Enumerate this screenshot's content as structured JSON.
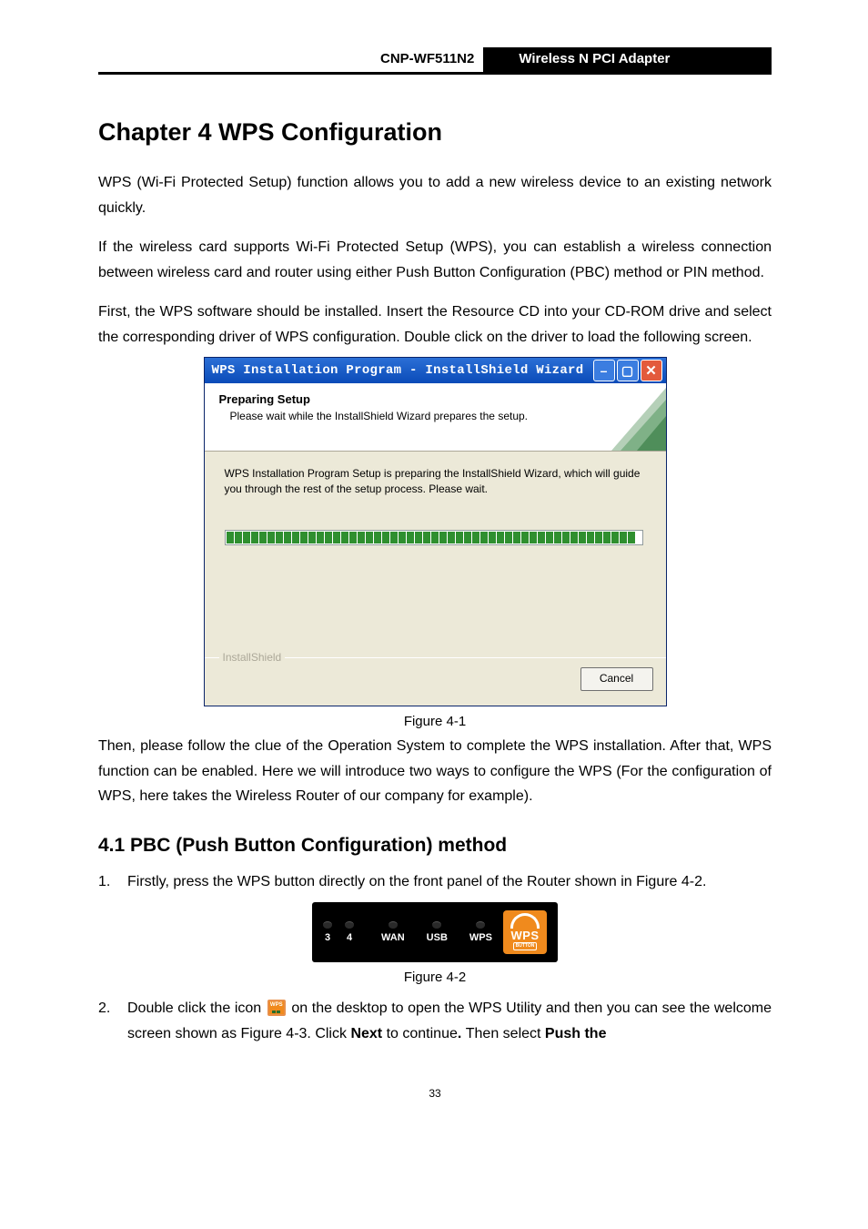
{
  "header": {
    "model": "CNP-WF511N2",
    "product": "Wireless N PCI Adapter"
  },
  "chapter_title": "Chapter 4  WPS Configuration",
  "paragraphs": {
    "p1": "WPS (Wi-Fi Protected Setup) function allows you to add a new wireless device to an existing network quickly.",
    "p2": "If the wireless card supports Wi-Fi Protected Setup (WPS), you can establish a wireless connection between wireless card and router using either Push Button Configuration (PBC) method or PIN method.",
    "p3": "First, the WPS software should be installed. Insert the Resource CD into your CD-ROM drive and select the corresponding driver of WPS configuration. Double click on the driver to load the following screen.",
    "p4": "Then, please follow the clue of the Operation System to complete the WPS installation. After that, WPS function can be enabled. Here we will introduce two ways to configure the WPS (For the configuration of WPS, here takes the Wireless Router of our company for example)."
  },
  "dialog": {
    "title": "WPS Installation Program - InstallShield Wizard",
    "header_title": "Preparing Setup",
    "header_sub": "Please wait while the InstallShield Wizard prepares the setup.",
    "body_text": "WPS Installation Program Setup is preparing the InstallShield Wizard, which will guide you through the rest of the setup process. Please wait.",
    "footer_label": "InstallShield",
    "cancel_label": "Cancel",
    "min_glyph": "–",
    "max_glyph": "▢",
    "close_glyph": "✕"
  },
  "figure_captions": {
    "fig1": "Figure 4-1",
    "fig2": "Figure 4-2"
  },
  "section_title": "4.1   PBC (Push Button Configuration) method",
  "list": {
    "item1_num": "1.",
    "item1_text": "Firstly, press the WPS button directly on the front panel of the Router shown in Figure 4-2.",
    "item2_num": "2.",
    "item2_a": "Double click the icon ",
    "item2_b": " on the desktop to open the WPS Utility and then you can see the welcome screen shown as Figure 4-3. Click ",
    "item2_next": "Next",
    "item2_c": " to continue",
    "item2_dot": ". ",
    "item2_d": "Then select ",
    "item2_push": "Push the"
  },
  "router": {
    "led3": "3",
    "led4": "4",
    "wan": "WAN",
    "usb": "USB",
    "wps": "WPS",
    "wps_btn_text": "WPS",
    "wps_btn_sub": "BUTTON"
  },
  "page_number": "33"
}
